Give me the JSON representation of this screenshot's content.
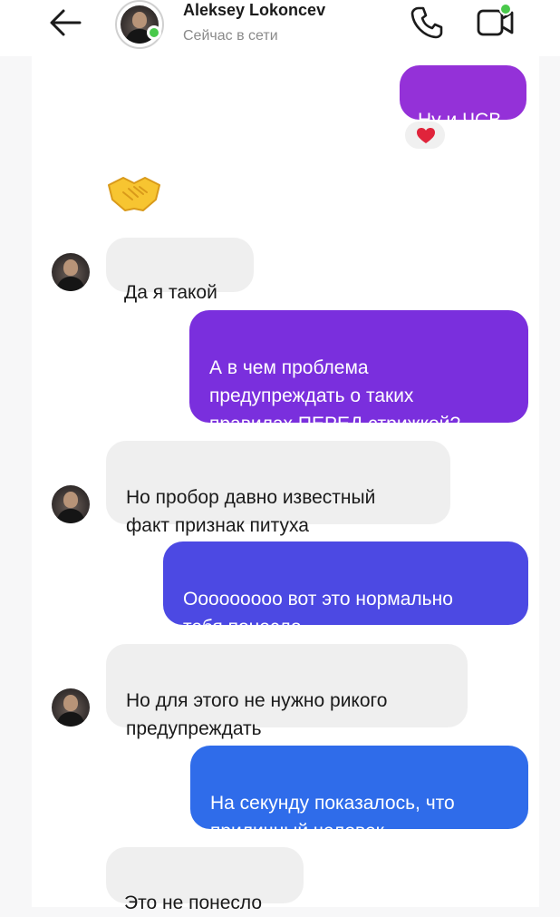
{
  "header": {
    "contact_name": "Aleksey Lokoncev",
    "status": "Сейчас в сети",
    "icons": [
      "back-arrow-icon",
      "phone-icon",
      "video-call-icon"
    ]
  },
  "colors": {
    "online": "#49c94b",
    "incoming_bubble": "#efefef",
    "outgoing_purple": "#8a2be0",
    "outgoing_violet": "#7a2fdd",
    "outgoing_indigo": "#4c49e3",
    "outgoing_blue": "#2f6cea",
    "heart": "#e0243b"
  },
  "messages": [
    {
      "direction": "out",
      "text": "Ну и ЧСВ",
      "reaction": "heart-icon"
    },
    {
      "direction": "in",
      "emoji": "handshake-icon"
    },
    {
      "direction": "in",
      "text": "Да я такой"
    },
    {
      "direction": "out",
      "text": "А в чем проблема\nпредупреждать о таких\nправилах ПЕРЕД стрижкой?"
    },
    {
      "direction": "in",
      "text": "Но пробор давно известный\nфакт признак питуха"
    },
    {
      "direction": "out",
      "text": "Ооооооооо вот это нормально\nтебя понесло"
    },
    {
      "direction": "in",
      "text": "Но для этого не нужно рикого\nпредупреждать"
    },
    {
      "direction": "out",
      "text": "На секунду показалось, что\nприличный человек"
    },
    {
      "direction": "in",
      "text": "Это не понесло"
    }
  ]
}
